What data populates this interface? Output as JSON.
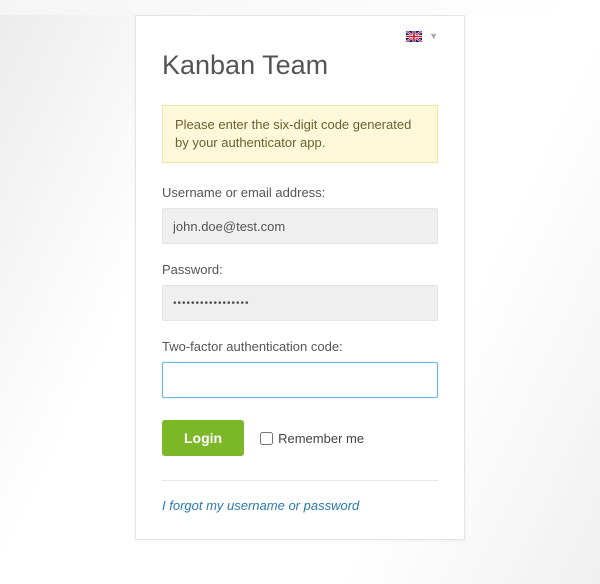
{
  "lang": {
    "flag": "uk",
    "arrow": "▼"
  },
  "title": "Kanban Team",
  "notice": "Please enter the six-digit code generated by your authenticator app.",
  "fields": {
    "username": {
      "label": "Username or email address:",
      "value": "john.doe@test.com"
    },
    "password": {
      "label": "Password:",
      "value": "•••••••••••••••••"
    },
    "tfa": {
      "label": "Two-factor authentication code:",
      "value": ""
    }
  },
  "actions": {
    "login_label": "Login",
    "remember_label": "Remember me",
    "remember_checked": false,
    "forgot_label": "I forgot my username or password"
  }
}
